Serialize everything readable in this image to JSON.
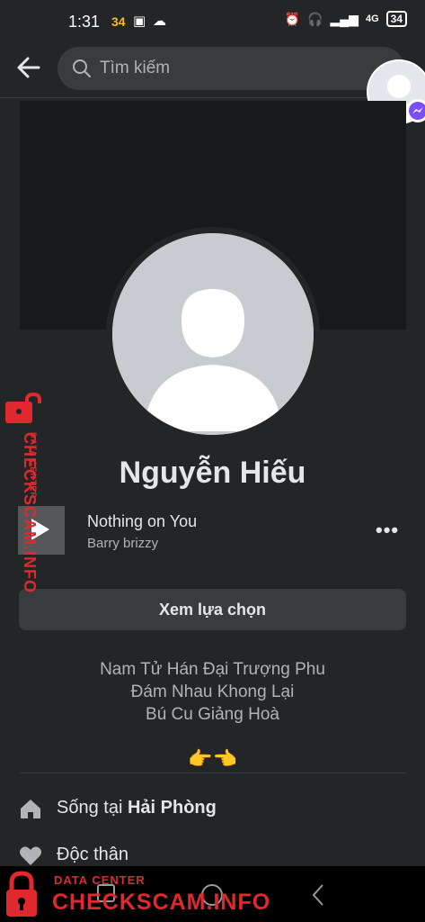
{
  "status_bar": {
    "time": "1:31",
    "notif_count": "34",
    "network": "4G",
    "battery": "34"
  },
  "search": {
    "placeholder": "Tìm kiếm"
  },
  "profile": {
    "name": "Nguyễn Hiếu",
    "music": {
      "title": "Nothing on You",
      "artist": "Barry brizzy",
      "more": "•••"
    },
    "options_label": "Xem lựa chọn",
    "bio": [
      "Nam Tử Hán Đại Trượng Phu",
      "Đám Nhau Khong Lại",
      "Bú Cu Giảng Hoà"
    ],
    "emoji": "👉👈",
    "info": [
      {
        "prefix": "Sống tại ",
        "value": "Hải Phòng",
        "icon": "home-icon"
      },
      {
        "prefix": "Độc thân",
        "value": "",
        "icon": "heart-icon"
      }
    ]
  },
  "watermark": {
    "main": "CHECKSCAM.INFO",
    "sub": "DATA CENTER"
  },
  "colors": {
    "background": "#242526",
    "surface": "#3a3b3c",
    "text": "#e4e6eb",
    "secondary": "#b0b3b8",
    "watermark": "#e0292e"
  }
}
